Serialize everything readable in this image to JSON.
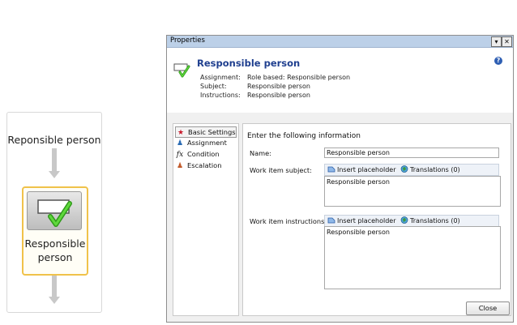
{
  "flow": {
    "top_label": "Reponsible person",
    "step_label": "Responsible person"
  },
  "dialog": {
    "window_title": "Properties",
    "title_buttons": {
      "dropdown": "▾",
      "close": "✕"
    },
    "header": {
      "title": "Responsible person",
      "rows": [
        {
          "label": "Assignment:",
          "value": "Role based: Responsible person"
        },
        {
          "label": "Subject:",
          "value": "Responsible person"
        },
        {
          "label": "Instructions:",
          "value": "Responsible person"
        }
      ]
    },
    "nav": {
      "items": [
        {
          "label": "Basic Settings",
          "icon": "red-star-icon",
          "glyph": "★",
          "color": "#c8182a",
          "selected": true
        },
        {
          "label": "Assignment",
          "icon": "users-icon",
          "glyph": "👥",
          "color": "#2b6bb3",
          "selected": false
        },
        {
          "label": "Condition",
          "icon": "function-icon",
          "glyph": "𝑓x",
          "color": "#333333",
          "selected": false
        },
        {
          "label": "Escalation",
          "icon": "escalation-users-icon",
          "glyph": "👥",
          "color": "#c25a2a",
          "selected": false
        }
      ]
    },
    "content": {
      "heading": "Enter the following information",
      "name_label": "Name:",
      "name_value": "Responsible person",
      "subject_label": "Work item subject:",
      "subject_value": "Responsible person",
      "instructions_label": "Work item instructions:",
      "instructions_value": "Responsible person",
      "insert_placeholder": "Insert placeholder",
      "translations": "Translations (0)"
    },
    "close_label": "Close"
  },
  "colors": {
    "title_blue": "#1f3f8f",
    "step_border": "#f0c24a",
    "check_green": "#3cb521",
    "titlebar": "#bcd0e8"
  }
}
